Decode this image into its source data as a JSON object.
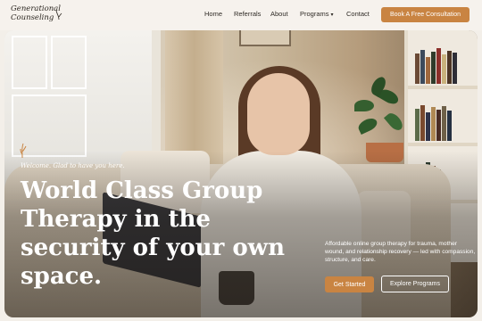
{
  "brand": {
    "logo_line1": "Generational",
    "logo_line2": "Counseling"
  },
  "nav": {
    "items": [
      {
        "label": "Home"
      },
      {
        "label": "Referrals"
      },
      {
        "label": "About"
      },
      {
        "label": "Programs",
        "icon": "chevron-down-icon"
      },
      {
        "label": "Contact"
      }
    ],
    "cta_label": "Book A Free Consultation"
  },
  "hero": {
    "eyebrow": "Welcome. Glad to have you here.",
    "headline_lines": [
      "World Class Group",
      "Therapy in the",
      "security of your own",
      "space."
    ],
    "subtext": "Affordable online group therapy for trauma, mother wound, and relationship recovery — led with compassion, structure, and care.",
    "primary_cta": "Get Started",
    "secondary_cta": "Explore Programs"
  },
  "colors": {
    "accent": "#c98442",
    "text_dark": "#2e2a25",
    "hero_text": "#ffffff"
  }
}
